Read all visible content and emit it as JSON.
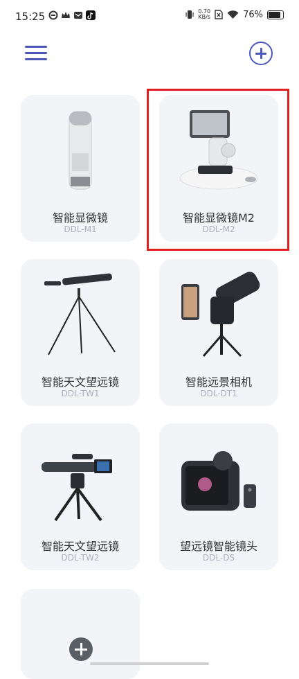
{
  "status_bar": {
    "time": "15:25",
    "net_speed_value": "0.70",
    "net_speed_unit": "KB/s",
    "battery": "76%"
  },
  "header": {
    "menu_icon": "hamburger-icon",
    "add_icon": "plus-circle-icon"
  },
  "devices": [
    {
      "name": "智能显微镜",
      "model": "DDL-M1"
    },
    {
      "name": "智能显微镜M2",
      "model": "DDL-M2"
    },
    {
      "name": "智能天文望远镜",
      "model": "DDL-TW1"
    },
    {
      "name": "智能远景相机",
      "model": "DDL-DT1"
    },
    {
      "name": "智能天文望远镜",
      "model": "DDL-TW2"
    },
    {
      "name": "望远镜智能镜头",
      "model": "DDL-DS"
    }
  ],
  "colors": {
    "accent": "#4b57b8",
    "card_bg": "#f2f4f8",
    "highlight": "#e02020"
  }
}
